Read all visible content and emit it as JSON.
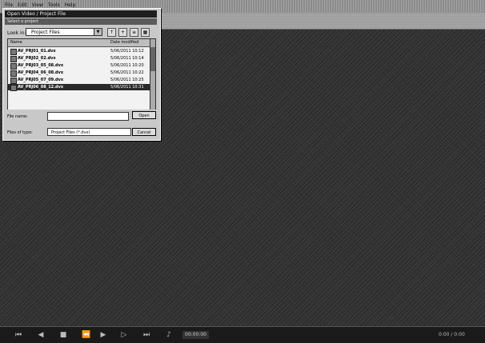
{
  "menu": [
    "File",
    "Edit",
    "View",
    "Tools",
    "Help"
  ],
  "dialog": {
    "title": "Open Video / Project File",
    "subtitle": "Select a project",
    "look_in_label": "Look in:",
    "look_in_value": "Project Files",
    "columns": {
      "name": "Name",
      "modified": "Date modified"
    },
    "files": [
      {
        "name": "AV_PRJ01_01.dvx",
        "date": "5/06/2011 10:12"
      },
      {
        "name": "AV_PRJ02_02.dvx",
        "date": "5/06/2011 10:14"
      },
      {
        "name": "AV_PRJ03_05_08.dvx",
        "date": "5/06/2011 10:20"
      },
      {
        "name": "AV_PRJ04_06_08.dvx",
        "date": "5/06/2011 10:22"
      },
      {
        "name": "AV_PRJ05_07_09.dvx",
        "date": "5/06/2011 10:25"
      },
      {
        "name": "AV_PRJ06_08_12.dvx",
        "date": "5/06/2011 10:31"
      }
    ],
    "selected_index": 5,
    "file_name_label": "File name:",
    "file_name_value": "",
    "file_type_label": "Files of type:",
    "file_type_value": "Project Files (*.dvx)",
    "open_label": "Open",
    "cancel_label": "Cancel"
  },
  "transport": {
    "timecode": "00:00:00",
    "right_info": "0:00 / 0:00"
  },
  "colors": {
    "workspace": "#333333",
    "dialog": "#c8c8c8",
    "selection": "#2a2a2a"
  }
}
